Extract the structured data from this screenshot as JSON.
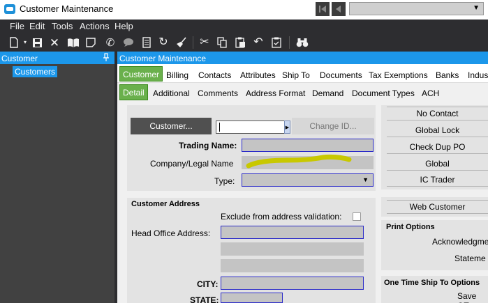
{
  "window": {
    "title": "Customer Maintenance"
  },
  "menu": [
    "File",
    "Edit",
    "Tools",
    "Actions",
    "Help"
  ],
  "toolbar": {
    "icons": [
      "new-icon",
      "save-icon",
      "delete-icon",
      "book-icon",
      "note-icon",
      "phone-icon",
      "comment-icon",
      "document-icon",
      "refresh-icon",
      "broom-icon",
      "cut-icon",
      "copy-icon",
      "paste-icon",
      "undo-icon",
      "clipboard-icon",
      "binoculars-icon",
      "first-record-icon",
      "previous-record-icon"
    ],
    "record_select_value": ""
  },
  "left_pane": {
    "title": "Customer",
    "tree_item": "Customers"
  },
  "main": {
    "title": "Customer Maintenance",
    "tabs": [
      "Customer",
      "Billing",
      "Contacts",
      "Attributes",
      "Ship To",
      "Documents",
      "Tax Exemptions",
      "Banks",
      "Indus"
    ],
    "subtabs": [
      "Detail",
      "Additional",
      "Comments",
      "Address Format",
      "Demand",
      "Document Types",
      "ACH"
    ]
  },
  "form": {
    "customer_button": "Customer...",
    "customer_id_value": "",
    "change_id_button": "Change ID...",
    "trading_name_label": "Trading Name:",
    "company_legal_label": "Company/Legal Name",
    "type_label": "Type:",
    "address_title": "Customer Address",
    "exclude_label": "Exclude from address validation:",
    "head_office_label": "Head Office Address:",
    "city_label": "CITY:",
    "state_label": "STATE:"
  },
  "right_buttons": [
    "No Contact",
    "Global Lock",
    "Check Dup PO",
    "Global",
    "IC Trader"
  ],
  "web_customer_button": "Web Customer",
  "print_options": {
    "title": "Print Options",
    "items": [
      "Acknowledgme",
      "Stateme"
    ]
  },
  "one_time_ship": {
    "title": "One Time Ship To Options",
    "item": "Save OT"
  },
  "colors": {
    "accent_blue": "#1c97ea",
    "tab_green": "#6ab04c",
    "dark_bg": "#2d2d30",
    "highlight_mark": "#c8c800"
  }
}
